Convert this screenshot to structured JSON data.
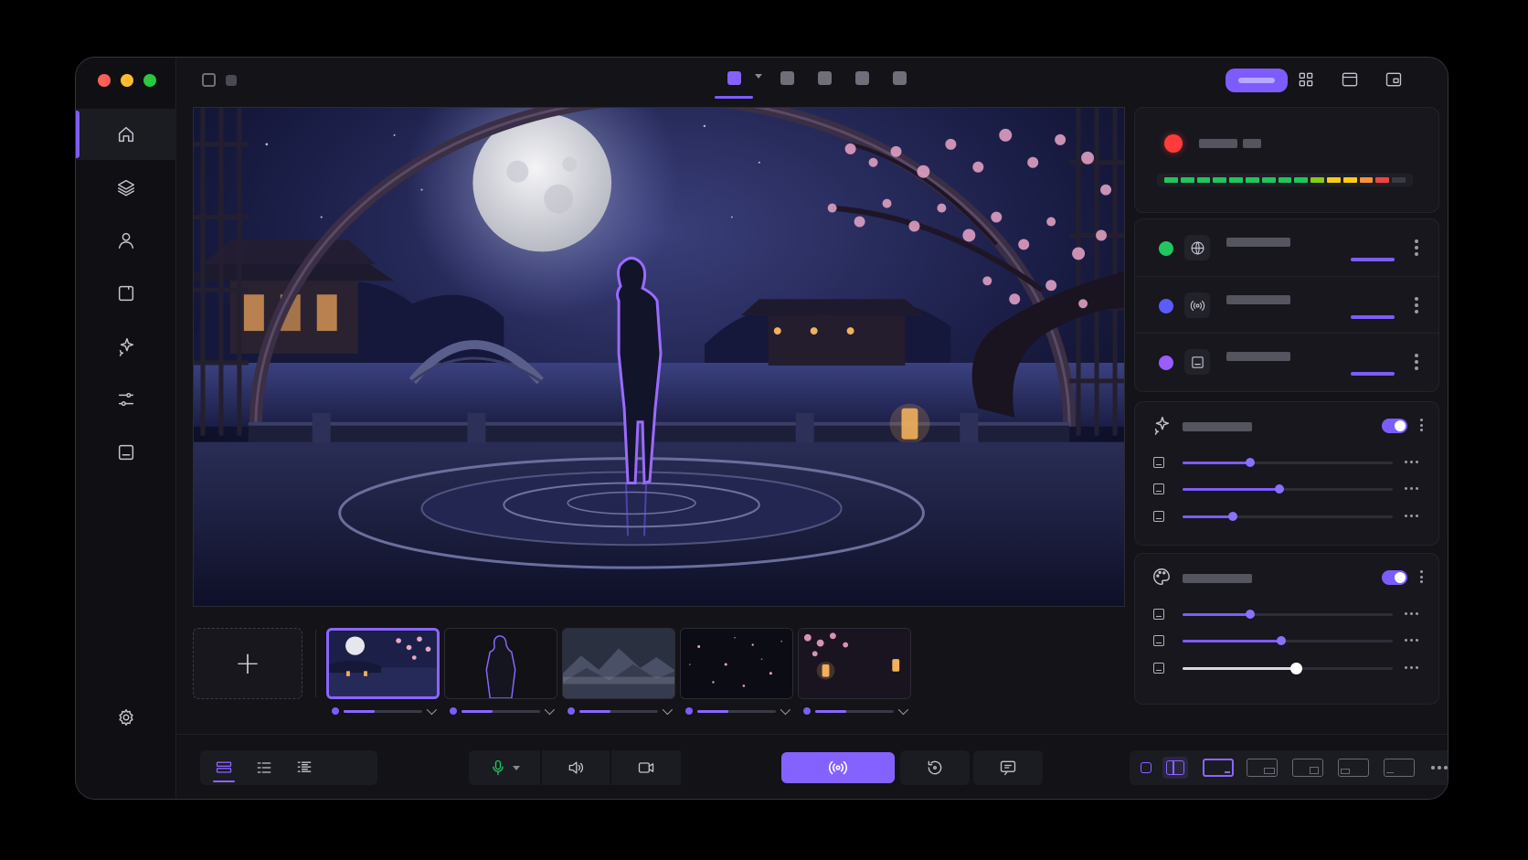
{
  "window": {
    "traffic_lights": {
      "close": "#ff5f57",
      "minimize": "#febc2e",
      "zoom": "#28c840"
    }
  },
  "colors": {
    "accent": "#7d5cff",
    "record": "#ff3b3b",
    "status_green": "#22c55e",
    "status_blue": "#5b5bff",
    "status_purple": "#9b5cff"
  },
  "sidebar": {
    "items": [
      {
        "name": "home-icon",
        "active": true
      },
      {
        "name": "layers-icon",
        "active": false
      },
      {
        "name": "user-icon",
        "active": false
      },
      {
        "name": "square-icon",
        "active": false
      },
      {
        "name": "sparkle-icon",
        "active": false
      },
      {
        "name": "sliders-icon",
        "active": false
      },
      {
        "name": "caption-icon",
        "active": false
      }
    ],
    "footer_icon": "gear-icon"
  },
  "topbar": {
    "scene_tabs": 5,
    "active_tab": 0,
    "right_icons": [
      "grid-icon",
      "window-icon",
      "picture-in-picture-icon"
    ]
  },
  "scenes": {
    "thumbnails": [
      "moonlit-garden",
      "silhouette",
      "misty-mountains",
      "starfield",
      "lantern-blossoms"
    ],
    "active_index": 0
  },
  "right_panel": {
    "recording": {
      "level": 0.9
    },
    "sources": [
      {
        "icon": "globe-icon",
        "status": "green"
      },
      {
        "icon": "broadcast-icon",
        "status": "blue"
      },
      {
        "icon": "caption-icon",
        "status": "purple"
      }
    ],
    "effects": {
      "icon": "sparkle-icon",
      "enabled": true,
      "levels": [
        0.32,
        0.46,
        0.24
      ]
    },
    "color": {
      "icon": "palette-icon",
      "enabled": true,
      "levels": [
        0.32,
        0.47,
        0.54
      ]
    }
  },
  "bottombar": {
    "view_modes": [
      "list-view-icon",
      "list-icon",
      "bullet-list-icon"
    ],
    "controls": [
      "microphone-icon",
      "speaker-icon",
      "camera-icon",
      "go-live-icon",
      "replay-icon",
      "chat-icon"
    ],
    "layouts": 8
  }
}
